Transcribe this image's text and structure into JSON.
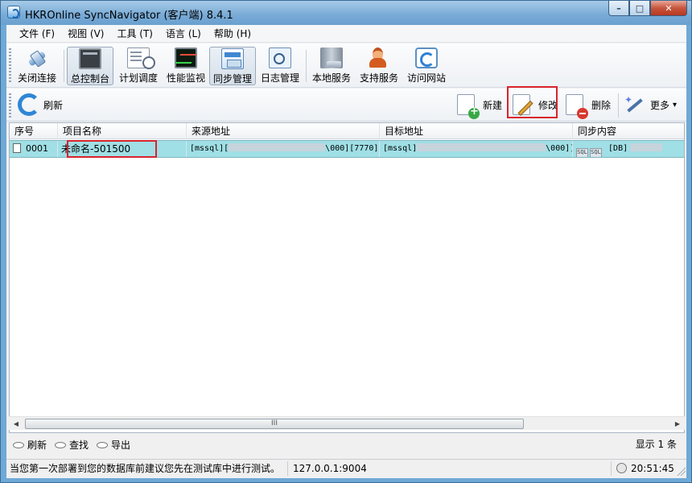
{
  "window": {
    "title": "HKROnline SyncNavigator (客户端) 8.4.1",
    "controls": {
      "minimize": "–",
      "maximize": "□",
      "close": "✕"
    }
  },
  "menu": [
    "文件 (F)",
    "视图 (V)",
    "工具 (T)",
    "语言 (L)",
    "帮助 (H)"
  ],
  "toolbar": {
    "buttons": [
      {
        "label": "关闭连接",
        "icon": "plug-icon"
      },
      {
        "label": "总控制台",
        "icon": "console-icon",
        "active": true
      },
      {
        "label": "计划调度",
        "icon": "schedule-icon"
      },
      {
        "label": "性能监视",
        "icon": "performance-monitor-icon"
      },
      {
        "label": "同步管理",
        "icon": "sync-manager-icon",
        "active": true
      },
      {
        "label": "日志管理",
        "icon": "log-icon"
      },
      {
        "label": "本地服务",
        "icon": "server-icon"
      },
      {
        "label": "支持服务",
        "icon": "support-person-icon"
      },
      {
        "label": "访问网站",
        "icon": "web-icon"
      }
    ]
  },
  "actions": {
    "refresh": "刷新",
    "new": "新建",
    "edit": "修改",
    "delete": "删除",
    "more": "更多",
    "more_arrow": "▾"
  },
  "grid": {
    "columns": [
      "序号",
      "项目名称",
      "来源地址",
      "目标地址",
      "同步内容"
    ],
    "rows": [
      {
        "index": "0001",
        "name": "未命名-501500",
        "source_prefix": "[mssql][",
        "source_tail": "\\000][7770]",
        "target_prefix": "[mssql]",
        "target_tail": "\\000]]",
        "content_sql1": "SQL",
        "content_sql2": "SQL",
        "content_text": "[DB]"
      }
    ]
  },
  "scrollbar": {
    "left": "◀",
    "right": "▶",
    "thumb": "III"
  },
  "bottom": {
    "refresh": "刷新",
    "find": "查找",
    "export": "导出",
    "count": "显示 1 条"
  },
  "status": {
    "message": "当您第一次部署到您的数据库前建议您先在测试库中进行测试。",
    "address": "127.0.0.1:9004",
    "time": "20:51:45"
  },
  "colors": {
    "selected_row": "#9fdfe5",
    "highlight_box": "#d9232d",
    "title_bar": "#78aad6"
  }
}
